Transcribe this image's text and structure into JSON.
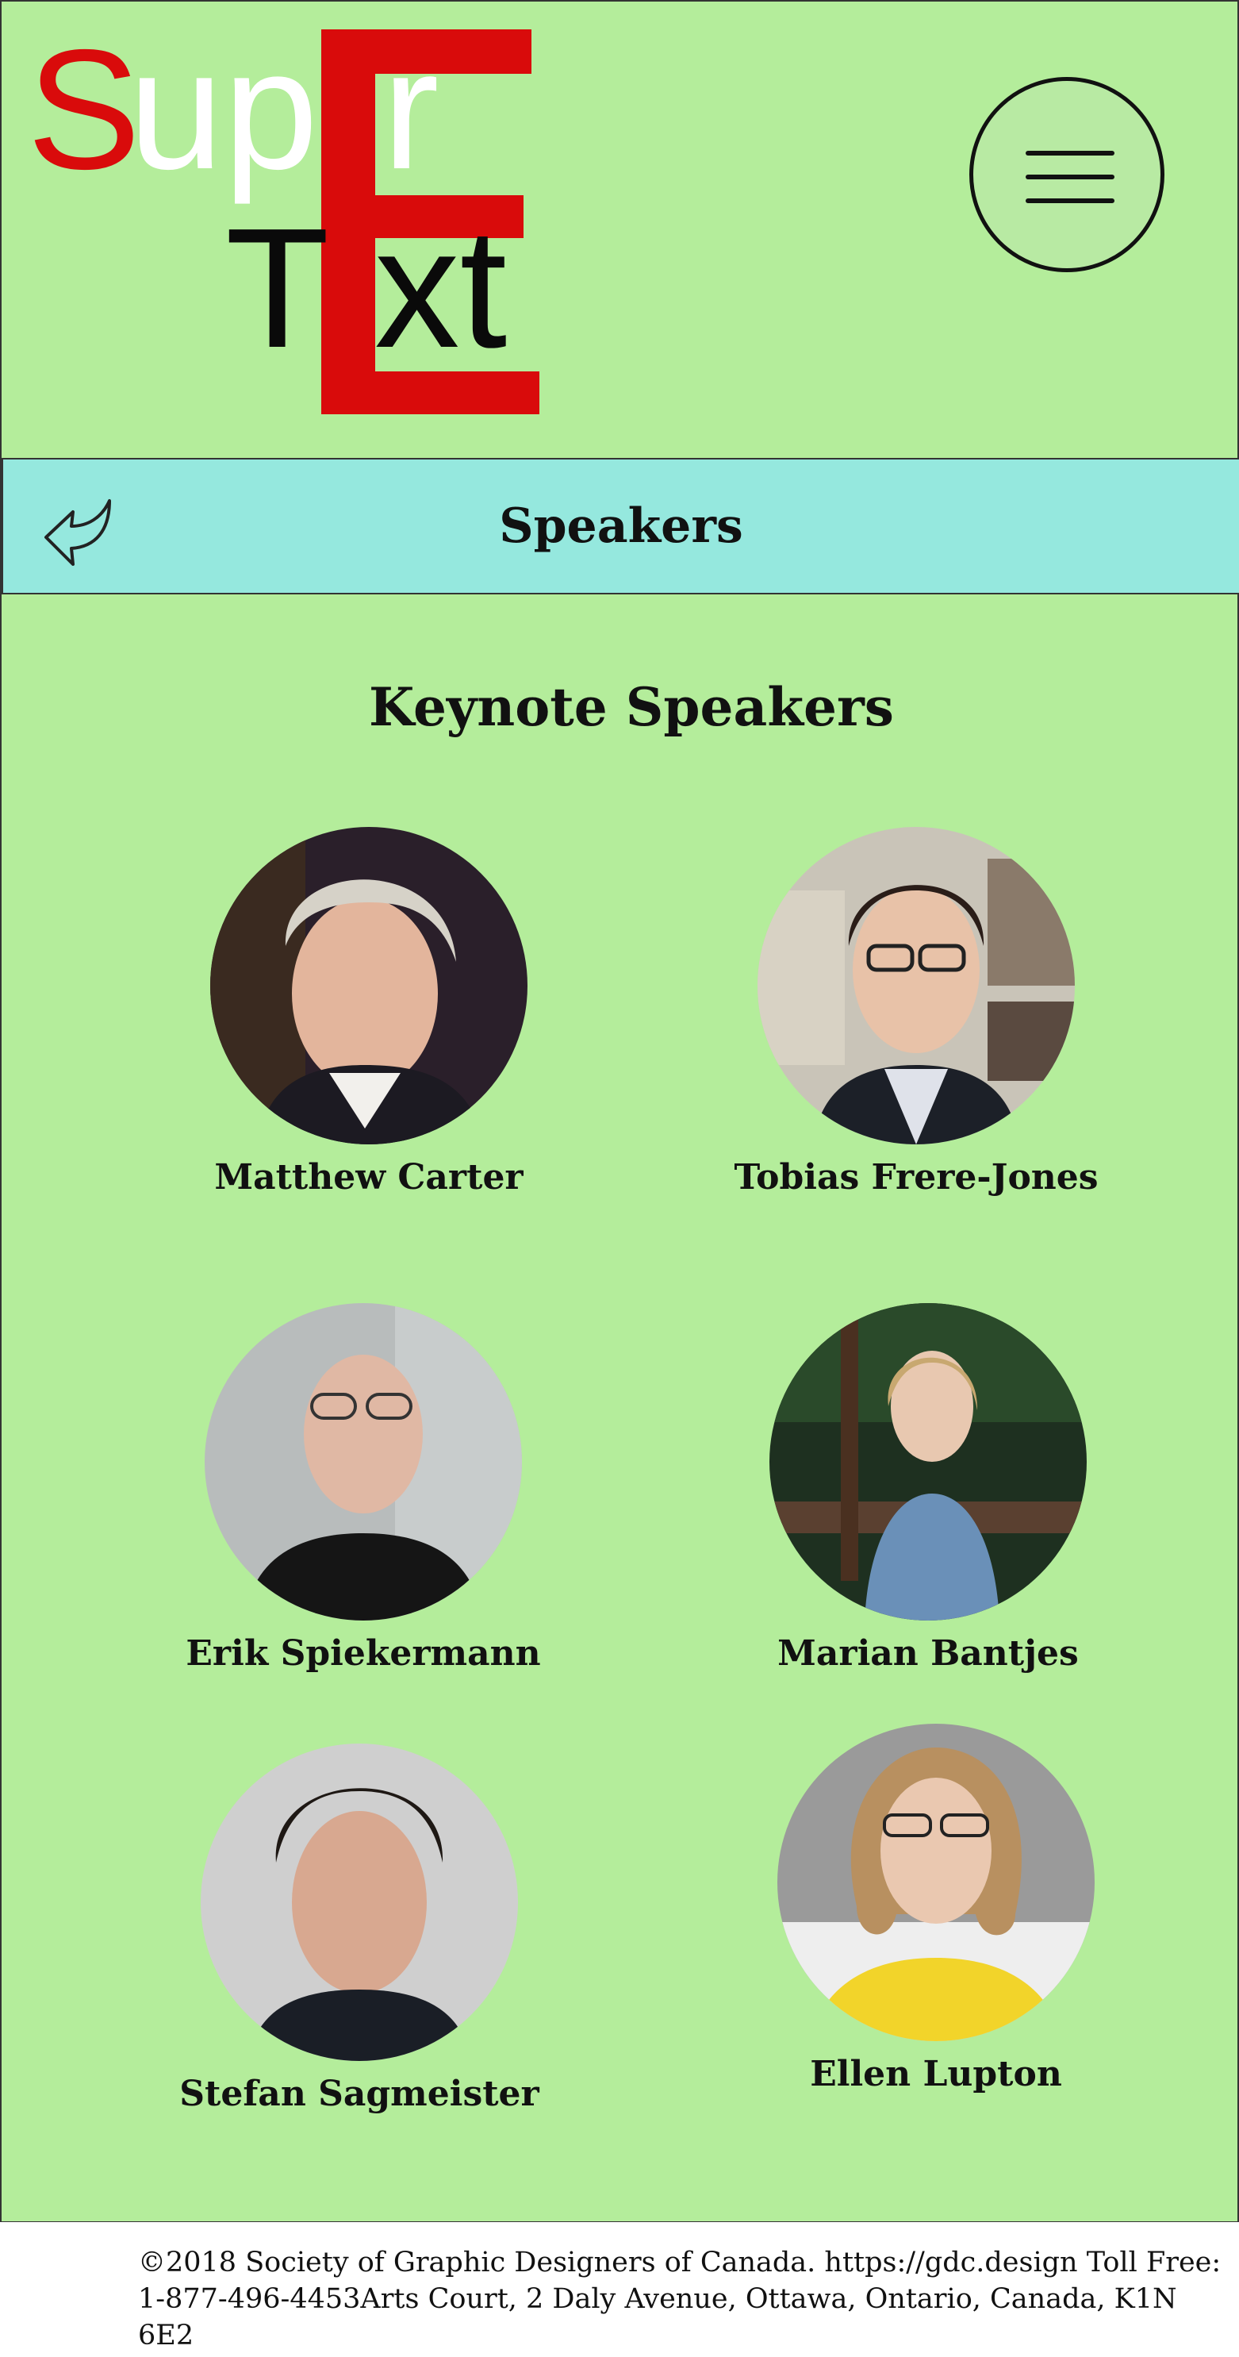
{
  "logo": {
    "line1_red": "S",
    "line1_white": "up",
    "line1_tail": "r",
    "big_letter": "E",
    "line2_left": "T",
    "line2_right": "xt",
    "colors": {
      "red": "#d90b0b",
      "white": "#ffffff",
      "black": "#0a0a0a"
    }
  },
  "header": {
    "menu_icon": "hamburger-menu-icon",
    "back_icon": "back-arrow-icon",
    "title": "Speakers"
  },
  "main": {
    "heading": "Keynote Speakers",
    "speakers": [
      {
        "name": "Matthew Carter"
      },
      {
        "name": "Tobias Frere-Jones"
      },
      {
        "name": "Erik Spiekermann"
      },
      {
        "name": "Marian Bantjes"
      },
      {
        "name": "Stefan Sagmeister"
      },
      {
        "name": "Ellen Lupton"
      }
    ]
  },
  "footer": {
    "text": "©2018 Society of Graphic Designers of Canada. https://gdc.design Toll Free: 1-877-496-4453Arts Court, 2 Daly Avenue, Ottawa, Ontario, Canada, K1N 6E2"
  },
  "colors": {
    "page_background": "#b4ed9b",
    "title_bar": "#95e8de",
    "footer_background": "#ffffff"
  }
}
